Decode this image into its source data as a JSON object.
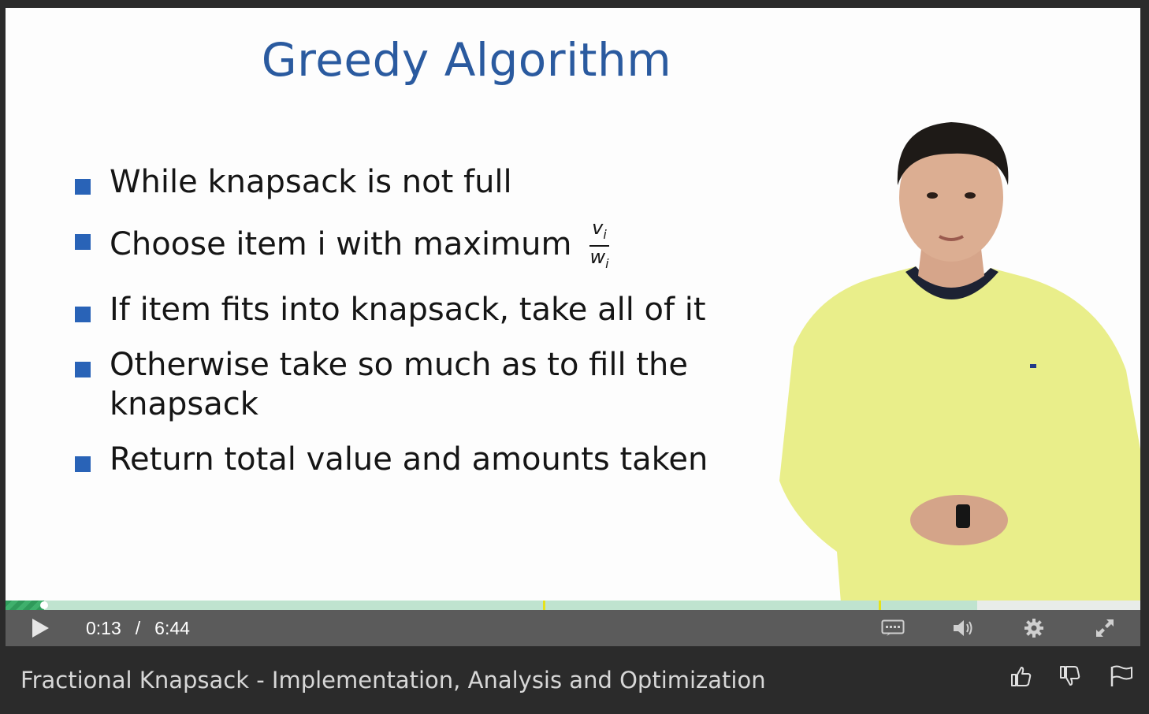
{
  "slide": {
    "title": "Greedy Algorithm",
    "bullets": [
      "While knapsack is not full",
      "Choose item i with maximum",
      "If item fits into knapsack, take all of it",
      "Otherwise take so much as to fill the knapsack",
      "Return total value and amounts taken"
    ],
    "fraction": {
      "numerator": "vi",
      "denominator": "wi"
    }
  },
  "player": {
    "current_time": "0:13",
    "separator": "/",
    "duration": "6:44",
    "played_fraction": 0.034,
    "buffered_fraction": 0.856,
    "cue_points": [
      0.474,
      0.77
    ],
    "colors": {
      "played": "#3fb06c",
      "buffered": "#bfe3cf",
      "cue": "#e5e21a",
      "bar": "#5b5b5b"
    },
    "icons": [
      "play-icon",
      "captions-icon",
      "volume-icon",
      "settings-icon",
      "fullscreen-icon"
    ]
  },
  "info": {
    "video_title": "Fractional Knapsack - Implementation, Analysis and Optimization",
    "icons": [
      "thumbs-up-icon",
      "thumbs-down-icon",
      "flag-icon"
    ]
  }
}
